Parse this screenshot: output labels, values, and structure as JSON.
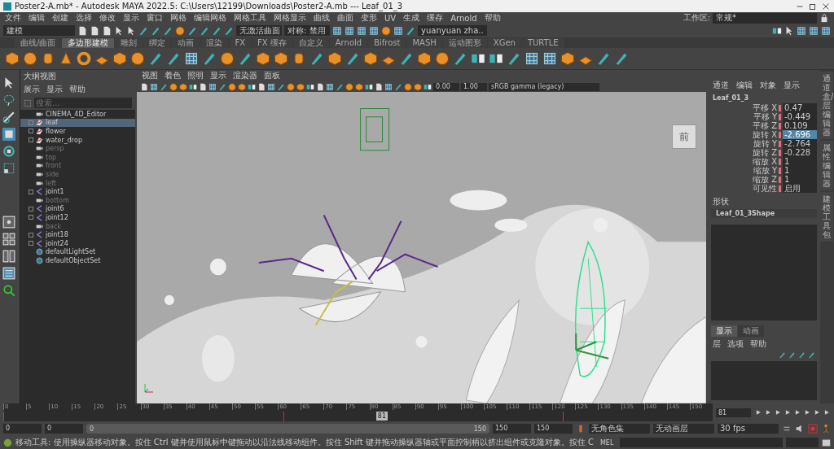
{
  "window": {
    "title": "Poster2-A.mb* - Autodesk MAYA 2022.5: C:\\Users\\12199\\Downloads\\Poster2-A.mb   ---   Leaf_01_3"
  },
  "menu": [
    "文件",
    "编辑",
    "创建",
    "选择",
    "修改",
    "显示",
    "窗口",
    "网格",
    "编辑网格",
    "网格工具",
    "网格显示",
    "曲线",
    "曲面",
    "变形",
    "UV",
    "生成",
    "缓存",
    "Arnold",
    "帮助"
  ],
  "workspace": {
    "label": "工作区:",
    "value": "常规*"
  },
  "toolbar": {
    "mode": "建模",
    "live_surface": "无激活曲面",
    "symmetry": "对称: 禁用",
    "user": "yuanyuan zha.."
  },
  "shelf_tabs": [
    {
      "label": "曲线/曲面",
      "selected": false
    },
    {
      "label": "多边形建模",
      "selected": true
    },
    {
      "label": "雕刻",
      "selected": false
    },
    {
      "label": "绑定",
      "selected": false
    },
    {
      "label": "动画",
      "selected": false
    },
    {
      "label": "渲染",
      "selected": false
    },
    {
      "label": "FX",
      "selected": false
    },
    {
      "label": "FX 缓存",
      "selected": false
    },
    {
      "label": "自定义",
      "selected": false
    },
    {
      "label": "Arnold",
      "selected": false
    },
    {
      "label": "Bifrost",
      "selected": false
    },
    {
      "label": "MASH",
      "selected": false
    },
    {
      "label": "运动图形",
      "selected": false
    },
    {
      "label": "XGen",
      "selected": false
    },
    {
      "label": "TURTLE",
      "selected": false
    }
  ],
  "outliner": {
    "title": "大纲视图",
    "menu": [
      "展示",
      "显示",
      "帮助"
    ],
    "search_placeholder": "搜索...",
    "items": [
      {
        "name": "CINEMA_4D_Editor",
        "kind": "camera",
        "expandable": false,
        "hidden": false,
        "selected": false
      },
      {
        "name": "leaf",
        "kind": "mesh",
        "expandable": true,
        "hidden": false,
        "selected": true
      },
      {
        "name": "flower",
        "kind": "mesh",
        "expandable": true,
        "hidden": false,
        "selected": false
      },
      {
        "name": "water_drop",
        "kind": "mesh",
        "expandable": true,
        "hidden": false,
        "selected": false
      },
      {
        "name": "persp",
        "kind": "camera",
        "expandable": false,
        "hidden": true,
        "selected": false
      },
      {
        "name": "top",
        "kind": "camera",
        "expandable": false,
        "hidden": true,
        "selected": false
      },
      {
        "name": "front",
        "kind": "camera",
        "expandable": false,
        "hidden": true,
        "selected": false
      },
      {
        "name": "side",
        "kind": "camera",
        "expandable": false,
        "hidden": true,
        "selected": false
      },
      {
        "name": "left",
        "kind": "camera",
        "expandable": false,
        "hidden": true,
        "selected": false
      },
      {
        "name": "joint1",
        "kind": "joint",
        "expandable": true,
        "hidden": false,
        "selected": false
      },
      {
        "name": "bottom",
        "kind": "camera",
        "expandable": false,
        "hidden": true,
        "selected": false
      },
      {
        "name": "joint6",
        "kind": "joint",
        "expandable": true,
        "hidden": false,
        "selected": false
      },
      {
        "name": "joint12",
        "kind": "joint",
        "expandable": true,
        "hidden": false,
        "selected": false
      },
      {
        "name": "back",
        "kind": "camera",
        "expandable": false,
        "hidden": true,
        "selected": false
      },
      {
        "name": "joint18",
        "kind": "joint",
        "expandable": true,
        "hidden": false,
        "selected": false
      },
      {
        "name": "joint24",
        "kind": "joint",
        "expandable": true,
        "hidden": false,
        "selected": false
      },
      {
        "name": "defaultLightSet",
        "kind": "set",
        "expandable": false,
        "hidden": false,
        "selected": false
      },
      {
        "name": "defaultObjectSet",
        "kind": "set",
        "expandable": false,
        "hidden": false,
        "selected": false
      }
    ]
  },
  "viewport": {
    "menu": [
      "视图",
      "着色",
      "照明",
      "显示",
      "渲染器",
      "面板"
    ],
    "exposure": "0.00",
    "gamma": "1.00",
    "color_space": "sRGB gamma (legacy)",
    "view_cube": "前"
  },
  "channel_box": {
    "menu": [
      "通道",
      "编辑",
      "对象",
      "显示"
    ],
    "object": "Leaf_01_3",
    "channels": [
      {
        "label": "平移 X",
        "value": "0.47",
        "selected": false
      },
      {
        "label": "平移 Y",
        "value": "-0.449",
        "selected": false
      },
      {
        "label": "平移 Z",
        "value": "0.109",
        "selected": false
      },
      {
        "label": "旋转 X",
        "value": "-2.696",
        "selected": true
      },
      {
        "label": "旋转 Y",
        "value": "-2.764",
        "selected": false
      },
      {
        "label": "旋转 Z",
        "value": "-0.228",
        "selected": false
      },
      {
        "label": "缩放 X",
        "value": "1",
        "selected": false
      },
      {
        "label": "缩放 Y",
        "value": "1",
        "selected": false
      },
      {
        "label": "缩放 Z",
        "value": "1",
        "selected": false
      },
      {
        "label": "可见性",
        "value": "启用",
        "selected": false
      }
    ],
    "shapes_label": "形状",
    "shape": "Leaf_01_3Shape"
  },
  "side_tabs": [
    "通道盒/层编辑器",
    "属性编辑器",
    "建模工具包"
  ],
  "layer_editor": {
    "tabs": [
      {
        "label": "显示",
        "selected": true
      },
      {
        "label": "动画",
        "selected": false
      }
    ],
    "menu": [
      "层",
      "选项",
      "帮助"
    ]
  },
  "timeline": {
    "ticks": [
      "0",
      "5",
      "10",
      "15",
      "20",
      "25",
      "30",
      "35",
      "40",
      "45",
      "50",
      "55",
      "60",
      "65",
      "70",
      "75",
      "80",
      "85",
      "90",
      "95",
      "100",
      "105",
      "110",
      "115",
      "120",
      "125",
      "130",
      "135",
      "140",
      "145",
      "150"
    ],
    "current_frame": "81",
    "playhead": {
      "level": 0.54
    },
    "keys": [
      {
        "level": 0
      },
      {
        "level": 0.4
      },
      {
        "level": 0.8
      }
    ],
    "frame_field": "81"
  },
  "range": {
    "level": 1,
    "start": "0",
    "anim_start": "0",
    "slider_start": "0",
    "slider_end": "150",
    "end": "150",
    "anim_end": "150",
    "character_set": "无角色集",
    "anim_layer": "无动画层",
    "fps": "30 fps"
  },
  "status": {
    "help": "移动工具: 使用操纵器移动对象。按住 Ctrl 键并使用鼠标中键拖动以沿法线移动组件。按住 Shift 键并拖动操纵器轴或平面控制柄以挤出组件或克隆对象。按住 C",
    "command_label": "MEL"
  }
}
